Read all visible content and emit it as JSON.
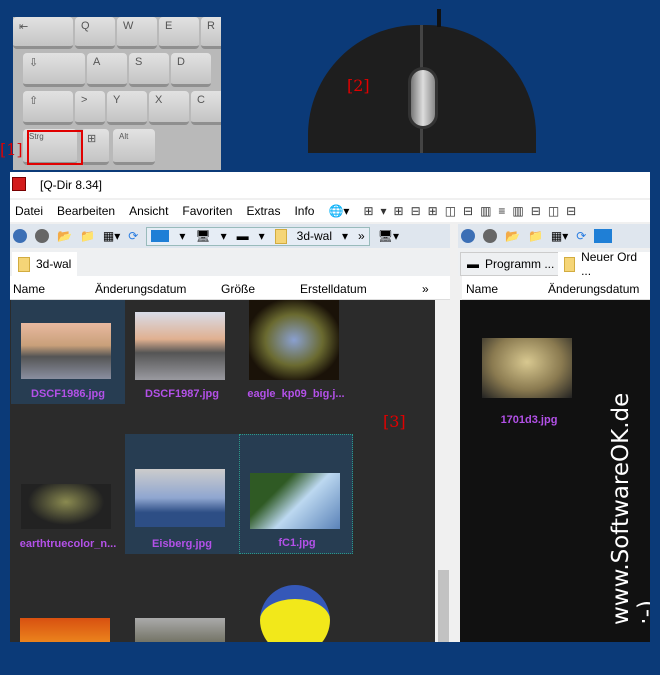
{
  "annotations": {
    "keyboard": "[1]",
    "mouse": "[2]",
    "view": "[3]"
  },
  "keyboard": {
    "keys": [
      "Q",
      "W",
      "E",
      "R",
      "A",
      "S",
      "D",
      "Y",
      "X",
      "C",
      "Strg",
      "Alt"
    ]
  },
  "window": {
    "title": "[Q-Dir 8.34]"
  },
  "menu": [
    "Datei",
    "Bearbeiten",
    "Ansicht",
    "Favoriten",
    "Extras",
    "Info"
  ],
  "left": {
    "address": "3d-wal",
    "tab": "3d-wal",
    "columns": [
      "Name",
      "Änderungsdatum",
      "Größe",
      "Erstelldatum"
    ],
    "files": [
      "DSCF1986.jpg",
      "DSCF1987.jpg",
      "eagle_kp09_big.j...",
      "earthtruecolor_n...",
      "Eisberg.jpg",
      "fC1.jpg"
    ]
  },
  "right": {
    "tabs": [
      "Programm ...",
      "Neuer Ord ..."
    ],
    "columns": [
      "Name",
      "Änderungsdatum"
    ],
    "files": [
      "1701d3.jpg"
    ]
  },
  "watermark": "www.SoftwareOK.de :-)",
  "colors": {
    "background": "#0b3a78",
    "filename": "#b351e8",
    "annotation": "#e00000"
  }
}
